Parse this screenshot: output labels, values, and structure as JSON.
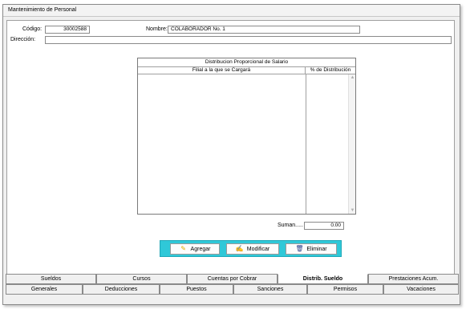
{
  "window": {
    "title": "Mantenimiento de Personal"
  },
  "form": {
    "codigo_label": "Código:",
    "codigo_value": "30002588",
    "nombre_label": "Nombre:",
    "nombre_value": "COLABORADOR No. 1",
    "direccion_label": "Dirección:",
    "direccion_value": ""
  },
  "grid": {
    "title": "Distribucion Proporcional de Salario",
    "col1": "Filial a la que se Cargará",
    "col2": "% de Distribución",
    "rows": []
  },
  "sum": {
    "label": "Suman.....",
    "value": "0.00"
  },
  "buttons": {
    "add": "Agregar",
    "edit": "Modificar",
    "delete": "Eliminar"
  },
  "tabs_row1": [
    {
      "label": "Sueldos"
    },
    {
      "label": "Cursos"
    },
    {
      "label": "Cuentas por Cobrar"
    },
    {
      "label": "Distrib. Sueldo"
    },
    {
      "label": "Prestaciones Acum."
    }
  ],
  "tabs_row2": [
    {
      "label": "Generales"
    },
    {
      "label": "Deducciones"
    },
    {
      "label": "Puestos"
    },
    {
      "label": "Sanciones"
    },
    {
      "label": "Permisos"
    },
    {
      "label": "Vacaciones"
    }
  ],
  "active_tab": "Distrib. Sueldo",
  "colors": {
    "accent": "#2fc8d8",
    "window_bg": "#f0f0f0"
  },
  "icons": {
    "add": "pencil-icon",
    "edit": "edit-note-icon",
    "delete": "trash-icon"
  }
}
